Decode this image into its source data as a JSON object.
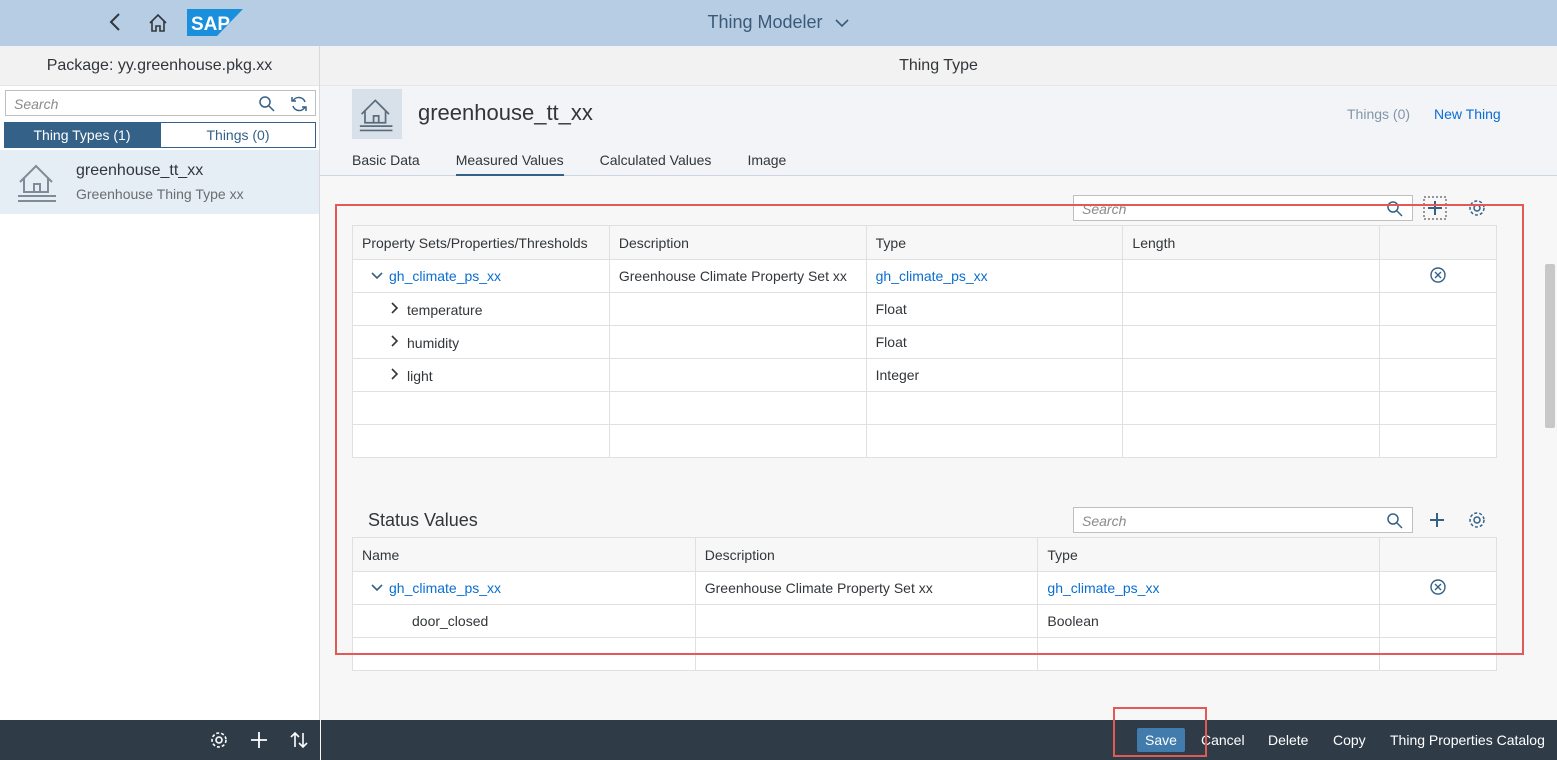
{
  "shell": {
    "title": "Thing Modeler",
    "logo_text": "SAP"
  },
  "master": {
    "header": "Package: yy.greenhouse.pkg.xx",
    "search_placeholder": "Search",
    "segments": [
      "Thing Types (1)",
      "Things (0)"
    ],
    "item": {
      "title": "greenhouse_tt_xx",
      "subtitle": "Greenhouse Thing Type xx"
    }
  },
  "detail": {
    "header": "Thing Type",
    "name": "greenhouse_tt_xx",
    "things_link": "Things (0)",
    "new_thing": "New Thing",
    "tabs": [
      "Basic Data",
      "Measured Values",
      "Calculated Values",
      "Image"
    ],
    "measured": {
      "search_placeholder": "Search",
      "columns": [
        "Property Sets/Properties/Thresholds",
        "Description",
        "Type",
        "Length"
      ],
      "rows": [
        {
          "name": "gh_climate_ps_xx",
          "desc": "Greenhouse Climate Property Set xx",
          "type": "gh_climate_ps_xx",
          "length": ""
        },
        {
          "name": "temperature",
          "desc": "",
          "type": "Float",
          "length": ""
        },
        {
          "name": "humidity",
          "desc": "",
          "type": "Float",
          "length": ""
        },
        {
          "name": "light",
          "desc": "",
          "type": "Integer",
          "length": ""
        }
      ]
    },
    "status": {
      "title": "Status Values",
      "search_placeholder": "Search",
      "columns": [
        "Name",
        "Description",
        "Type"
      ],
      "rows": [
        {
          "name": "gh_climate_ps_xx",
          "desc": "Greenhouse Climate Property Set xx",
          "type": "gh_climate_ps_xx"
        },
        {
          "name": "door_closed",
          "desc": "",
          "type": "Boolean"
        }
      ]
    }
  },
  "footer": {
    "save": "Save",
    "cancel": "Cancel",
    "delete": "Delete",
    "copy": "Copy",
    "catalog": "Thing Properties Catalog"
  },
  "colors": {
    "shell": "#b7cde3",
    "footer": "#2f3c48",
    "accent": "#346187",
    "link": "#0a6ed1",
    "highlight": "#e25a57"
  }
}
